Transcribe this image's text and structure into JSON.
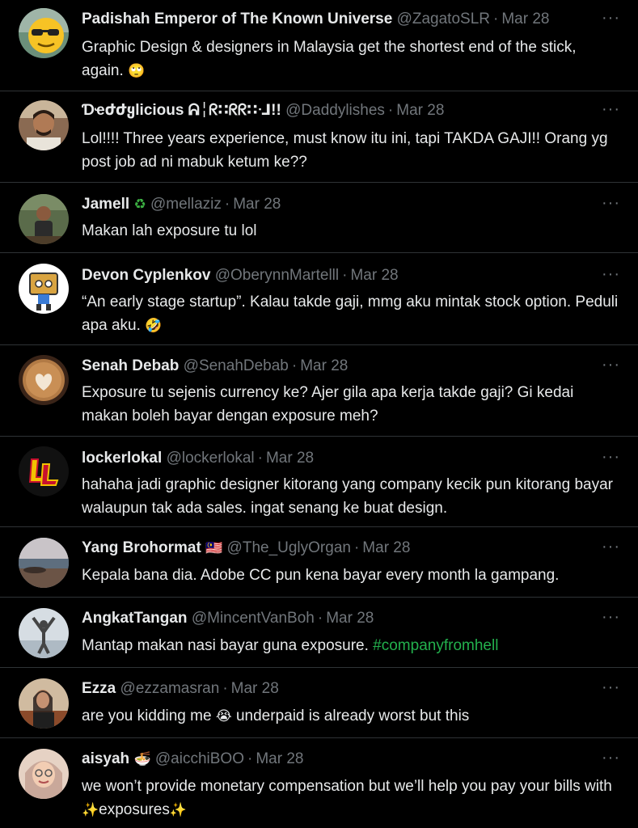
{
  "tweets": [
    {
      "name": "Padishah Emperor of The Known Universe",
      "handle": "@ZagatoSLR",
      "time": "Mar 28",
      "badge": "",
      "text": "Graphic Design & designers in Malaysia get the shortest end of the stick, again.",
      "text_emoji": "🙄",
      "hashtag": "",
      "avatar": "sunglasses-emoji-avatar"
    },
    {
      "name": "Ɗҽժժყlicious ᕱ╎ᖇ∷ᖇᖇ∷ᒲ!!",
      "handle": "@Daddylishes",
      "time": "Mar 28",
      "badge": "",
      "text": "Lol!!!! Three years experience, must know itu ini, tapi TAKDA GAJI!! Orang yg post job ad ni mabuk ketum ke??",
      "text_emoji": "",
      "hashtag": "",
      "avatar": "man-photo-avatar"
    },
    {
      "name": "Jamell",
      "handle": "@mellaziz",
      "time": "Mar 28",
      "badge": "♻",
      "text": "Makan lah exposure tu lol",
      "text_emoji": "",
      "hashtag": "",
      "avatar": "man-outdoor-avatar"
    },
    {
      "name": "Devon Cyplenkov",
      "handle": "@OberynnMartelll",
      "time": "Mar 28",
      "badge": "",
      "text": "“An early stage startup”. Kalau takde gaji, mmg aku mintak stock option. Peduli apa aku.",
      "text_emoji": "🤣",
      "hashtag": "",
      "avatar": "cartoon-avatar"
    },
    {
      "name": "Senah Debab",
      "handle": "@SenahDebab",
      "time": "Mar 28",
      "badge": "",
      "text": "Exposure tu sejenis currency ke? Ajer gila apa kerja takde gaji? Gi kedai makan boleh bayar dengan exposure meh?",
      "text_emoji": "",
      "hashtag": "",
      "avatar": "latte-art-avatar"
    },
    {
      "name": "lockerlokal",
      "handle": "@lockerlokal",
      "time": "Mar 28",
      "badge": "",
      "text": "hahaha jadi graphic designer kitorang yang company kecik pun kitorang bayar walaupun tak ada sales. ingat senang ke buat design.",
      "text_emoji": "",
      "hashtag": "",
      "avatar": "ll-logo-avatar"
    },
    {
      "name": "Yang Brohormat",
      "handle": "@The_UglyOrgan",
      "time": "Mar 28",
      "badge": "🇲🇾",
      "text": "Kepala bana dia. Adobe CC pun kena bayar every month la gampang.",
      "text_emoji": "",
      "hashtag": "",
      "avatar": "seascape-avatar"
    },
    {
      "name": "AngkatTangan",
      "handle": "@MincentVanBoh",
      "time": "Mar 28",
      "badge": "",
      "text": "Mantap makan nasi bayar guna exposure.",
      "text_emoji": "",
      "hashtag": "#companyfromhell",
      "avatar": "raised-arms-avatar"
    },
    {
      "name": "Ezza",
      "handle": "@ezzamasran",
      "time": "Mar 28",
      "badge": "",
      "text": "are you kidding me",
      "text_emoji": "😭",
      "text_after": "underpaid is already worst but this",
      "hashtag": "",
      "avatar": "woman-photo-avatar"
    },
    {
      "name": "aisyah",
      "handle": "@aicchiBOO",
      "time": "Mar 28",
      "badge": "🍜",
      "text": "we won’t provide monetary compensation but we’ll help you pay your bills with",
      "text_emoji": "✨",
      "text_after": "exposures",
      "text_emoji2": "✨",
      "hashtag": "",
      "avatar": "hijab-woman-avatar"
    }
  ],
  "more_label": "···",
  "separator": "·",
  "colors": {
    "background": "#000000",
    "text": "#e7e9ea",
    "muted": "#71767b",
    "hashtag": "#23b14d",
    "divider": "#2f3336"
  }
}
